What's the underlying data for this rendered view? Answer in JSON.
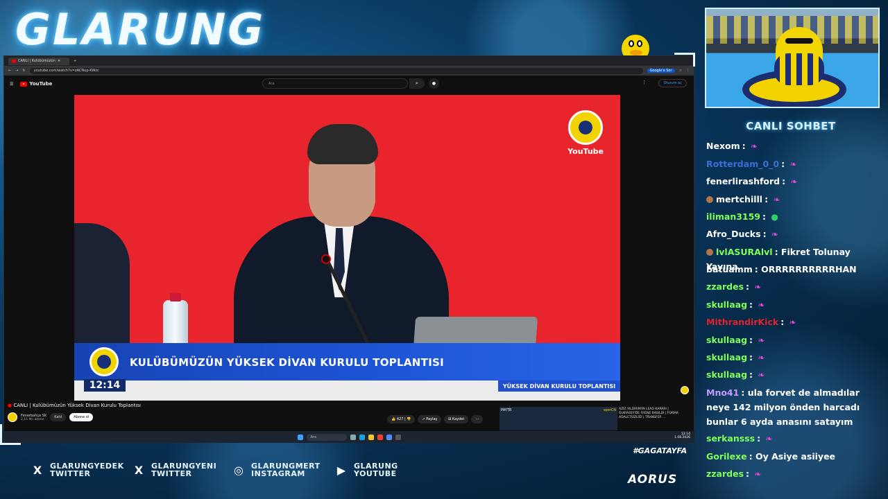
{
  "overlay": {
    "brand": "GLARUNG",
    "chat_title": "CANLI SOHBET",
    "hashtag": "#GAGATAYFA",
    "sponsor": "AORUS"
  },
  "browser": {
    "tab_title": "CANLI | Kulübümüzün",
    "url": "youtube.com/watch?v=zACNup-KWzc",
    "google_sor": "Google'a Sor"
  },
  "youtube": {
    "logo": "YouTube",
    "search_placeholder": "Ara",
    "sign_in": "Oturum aç",
    "watermark": "YouTube",
    "video_title": "CANLI | Kulübümüzün Yüksek Divan Kurulu Toplantısı",
    "channel_name": "Fenerbahçe SK",
    "subscribers": "2,15 Mn abone",
    "join_label": "Katıl",
    "subscribe_label": "Abone ol",
    "likes": "427",
    "share_label": "Paylaş",
    "save_label": "Kaydet",
    "rec_channel": "PAYTR",
    "rec_brand": "sporCN",
    "rec_title": "AZİZ YILDIRIM'IN LEAO KARARI | GUIRASSY'DE FRENE BASILDI | FORMA ADALETSİZLİĞİ | TRANSFER ..."
  },
  "broadcast": {
    "lower_third": "KULÜBÜMÜZÜN YÜKSEK DİVAN KURULU TOPLANTISI",
    "time": "12:14",
    "sub_label": "YÜKSEK DİVAN KURULU TOPLANTISI"
  },
  "taskbar": {
    "search": "Ara",
    "time": "12:14",
    "date": "1.08.2026"
  },
  "chat": [
    {
      "user": "Nexom",
      "color": "#ffffff",
      "text": "",
      "emote": "pink",
      "badge": false
    },
    {
      "user": "Rotterdam_0_0",
      "color": "#3a6fd8",
      "text": "",
      "emote": "pink",
      "badge": false
    },
    {
      "user": "fenerlirashford",
      "color": "#ffffff",
      "text": "",
      "emote": "pink",
      "badge": false
    },
    {
      "user": "mertchilll",
      "color": "#ffffff",
      "text": "",
      "emote": "pink",
      "badge": true
    },
    {
      "user": "iliman3159",
      "color": "#7fff5a",
      "text": "",
      "emote": "globe",
      "badge": false
    },
    {
      "user": "Afro_Ducks",
      "color": "#ffffff",
      "text": "",
      "emote": "pink",
      "badge": false
    },
    {
      "user": "lvlASURAlvl",
      "color": "#7fff5a",
      "text": "Fikret Tolunay Yayına",
      "emote": "",
      "badge": true
    },
    {
      "user": "batuamm",
      "color": "#ffffff",
      "text": "ORRRRRRRRRRHAN",
      "emote": "",
      "badge": false
    },
    {
      "user": "zzardes",
      "color": "#7fff5a",
      "text": "",
      "emote": "pink",
      "badge": false
    },
    {
      "user": "skullaag",
      "color": "#7fff5a",
      "text": "",
      "emote": "pink",
      "badge": false
    },
    {
      "user": "MithrandirKick",
      "color": "#e0242c",
      "text": "",
      "emote": "pink",
      "badge": false
    },
    {
      "user": "skullaag",
      "color": "#7fff5a",
      "text": "",
      "emote": "pink",
      "badge": false
    },
    {
      "user": "skullaag",
      "color": "#7fff5a",
      "text": "",
      "emote": "pink",
      "badge": false
    },
    {
      "user": "skullaag",
      "color": "#7fff5a",
      "text": "",
      "emote": "pink",
      "badge": false
    },
    {
      "user": "Mno41",
      "color": "#c39bff",
      "text": "ula forvet de almadılar neye 142 milyon önden harcadı bunlar 6 ayda anasını satayım",
      "emote": "",
      "badge": false
    },
    {
      "user": "serkansss",
      "color": "#7fff5a",
      "text": "",
      "emote": "pink",
      "badge": false
    },
    {
      "user": "Gorilexe",
      "color": "#7fff5a",
      "text": "Oy Asiye asiiyee",
      "emote": "",
      "badge": false
    },
    {
      "user": "zzardes",
      "color": "#7fff5a",
      "text": "",
      "emote": "pink",
      "badge": false
    }
  ],
  "socials": [
    {
      "icon": "x-icon",
      "line1": "GLARUNGYEDEK",
      "line2": "TWITTER"
    },
    {
      "icon": "x-icon",
      "line1": "GLARUNGYENI",
      "line2": "TWITTER"
    },
    {
      "icon": "instagram-icon",
      "line1": "GLARUNGMERT",
      "line2": "INSTAGRAM"
    },
    {
      "icon": "youtube-icon",
      "line1": "GLARUNG",
      "line2": "YOUTUBE"
    }
  ]
}
